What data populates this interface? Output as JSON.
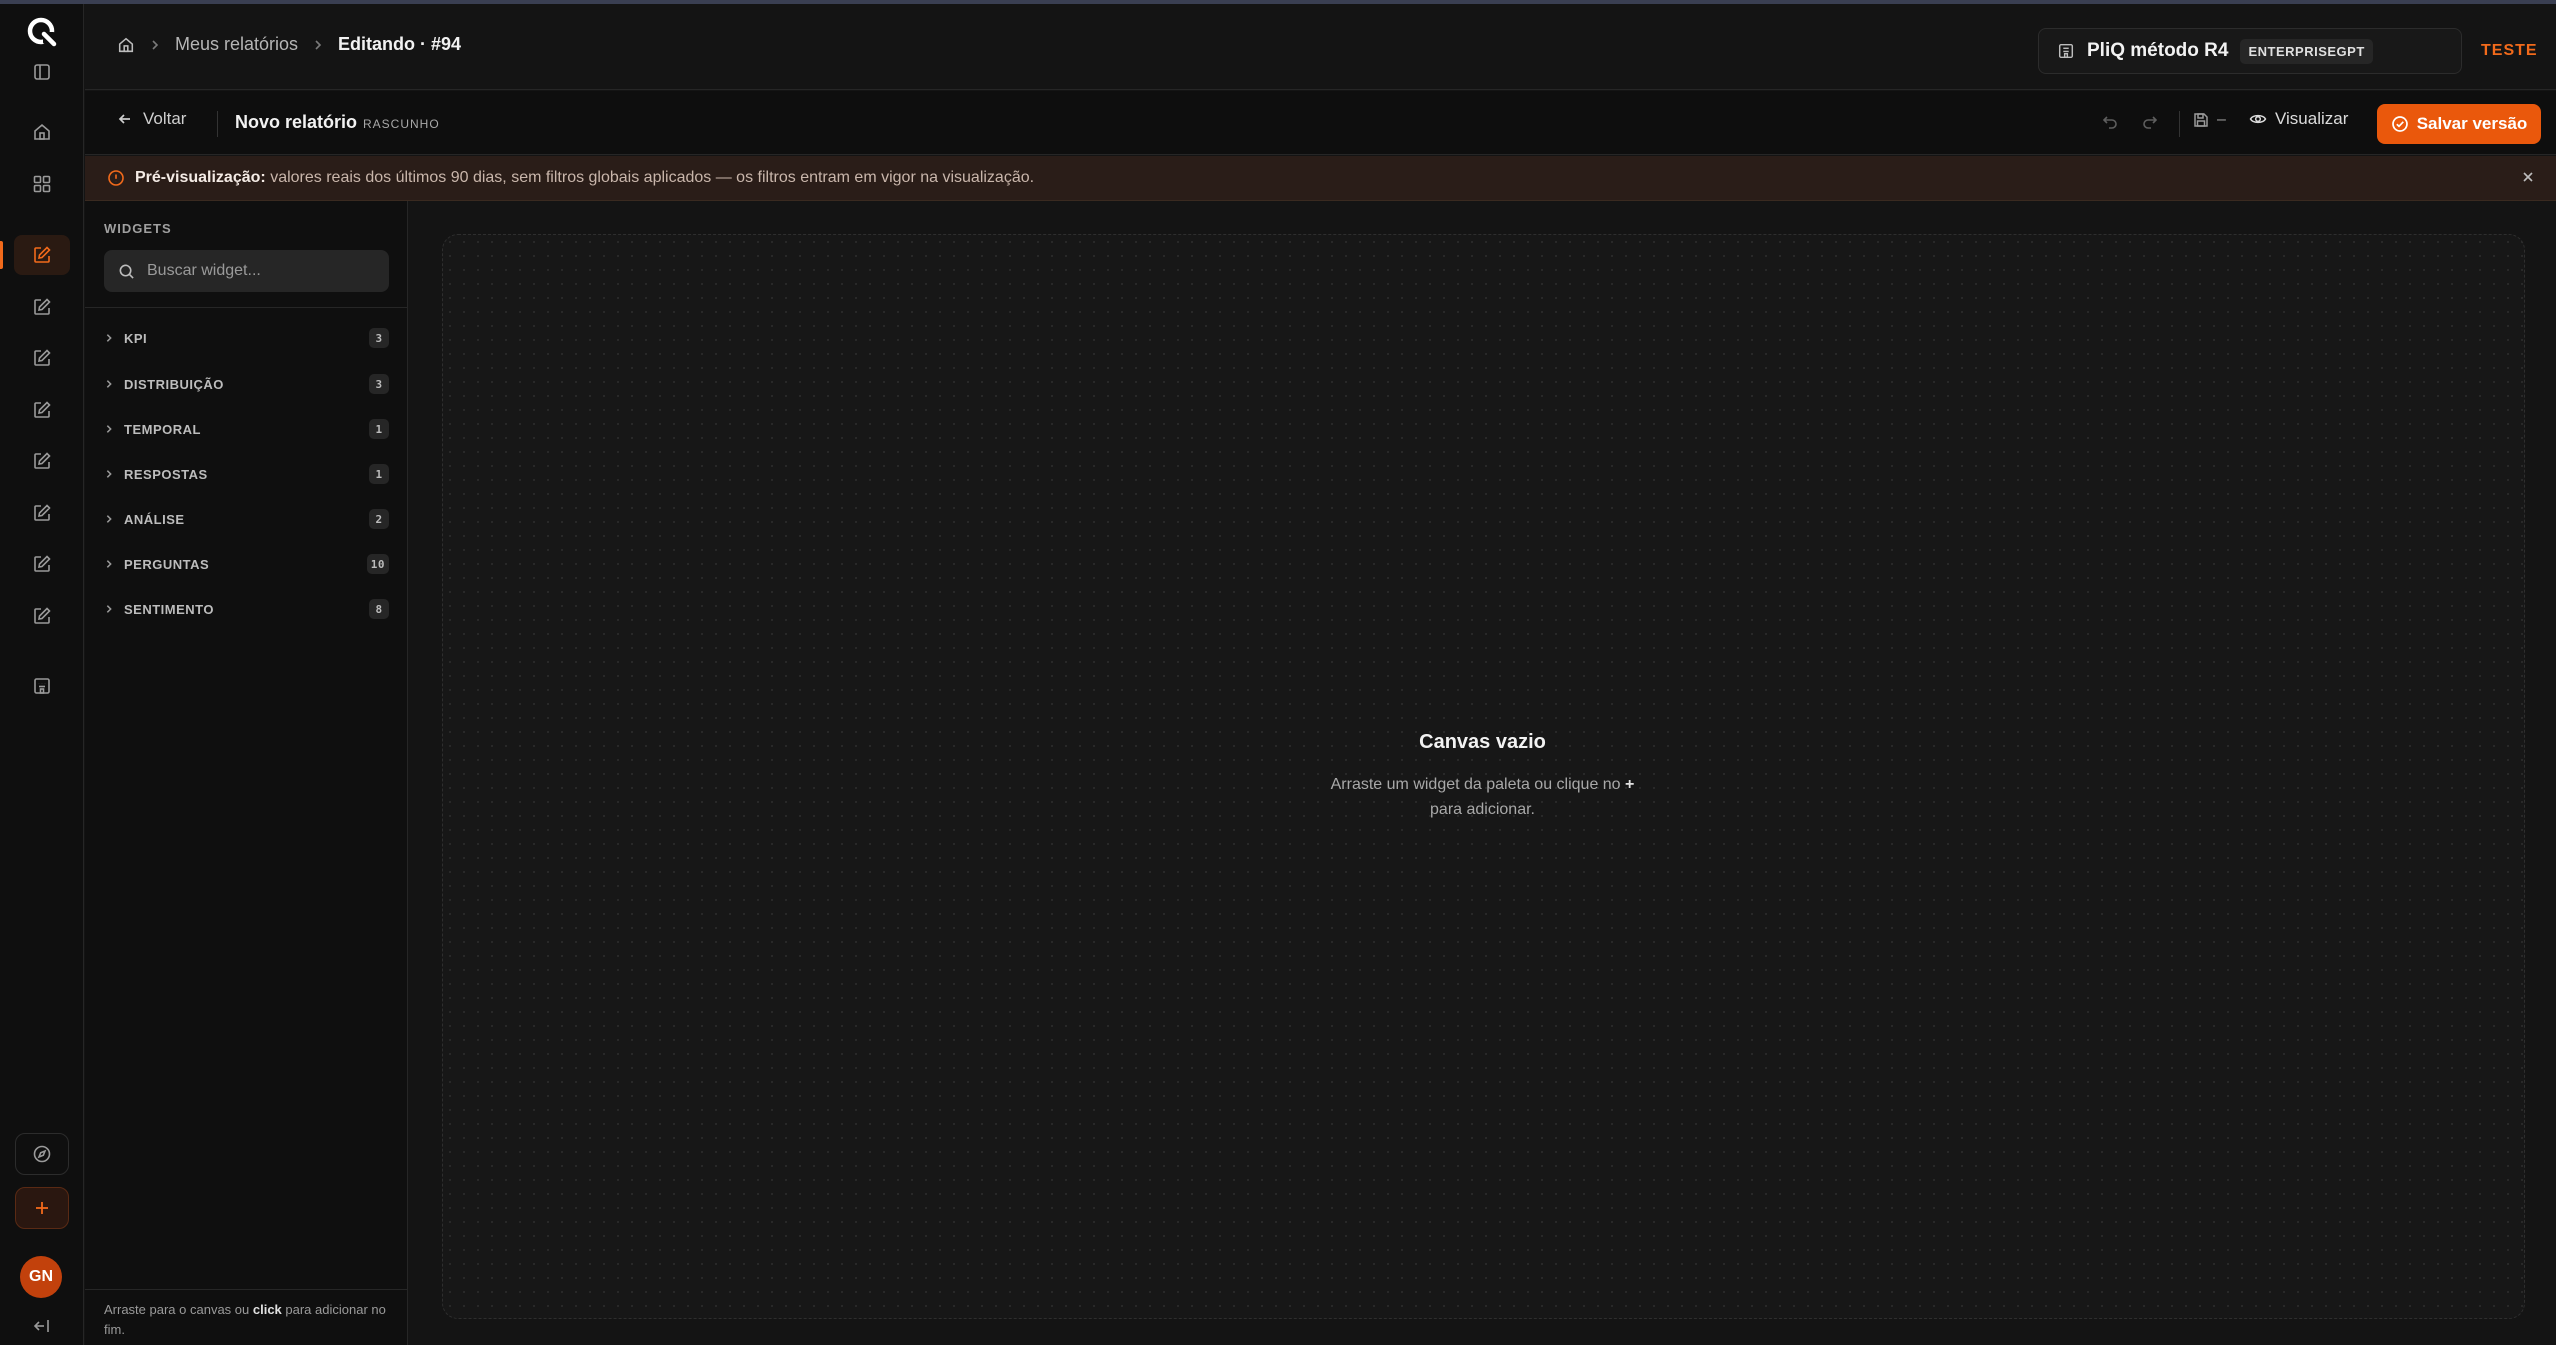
{
  "breadcrumb": {
    "parent": "Meus relatórios",
    "current": "Editando · #94"
  },
  "org": {
    "name": "PliQ método R4",
    "tag": "ENTERPRISEGPT"
  },
  "environment": "TESTE",
  "toolbar": {
    "back": "Voltar",
    "title": "Novo relatório",
    "status": "RASCUNHO",
    "save_state": "–",
    "preview": "Visualizar",
    "save": "Salvar versão"
  },
  "banner": {
    "label": "Pré-visualização:",
    "text": "valores reais dos últimos 90 dias, sem filtros globais aplicados — os filtros entram em vigor na visualização."
  },
  "palette": {
    "heading": "WIDGETS",
    "search_placeholder": "Buscar widget...",
    "categories": [
      {
        "label": "KPI",
        "count": "3"
      },
      {
        "label": "DISTRIBUIÇÃO",
        "count": "3"
      },
      {
        "label": "TEMPORAL",
        "count": "1"
      },
      {
        "label": "RESPOSTAS",
        "count": "1"
      },
      {
        "label": "ANÁLISE",
        "count": "2"
      },
      {
        "label": "PERGUNTAS",
        "count": "10"
      },
      {
        "label": "SENTIMENTO",
        "count": "8"
      }
    ],
    "footer": {
      "pre": "Arraste para o canvas ou ",
      "bold": "click",
      "post": " para adicionar no fim."
    }
  },
  "canvas": {
    "title": "Canvas vazio",
    "text_pre": "Arraste um widget da paleta ou clique no ",
    "text_bold": "+",
    "text_post": " para adicionar."
  },
  "user": {
    "initials": "GN"
  },
  "colors": {
    "accent": "#ea580c",
    "background": "#141414",
    "banner": "#2a1d18"
  },
  "icons": {
    "rail": [
      "logo-icon",
      "panel-toggle-icon",
      "home-icon",
      "grid-icon",
      "edit-report-icon",
      "compass-icon",
      "plus-icon",
      "collapse-icon"
    ]
  }
}
